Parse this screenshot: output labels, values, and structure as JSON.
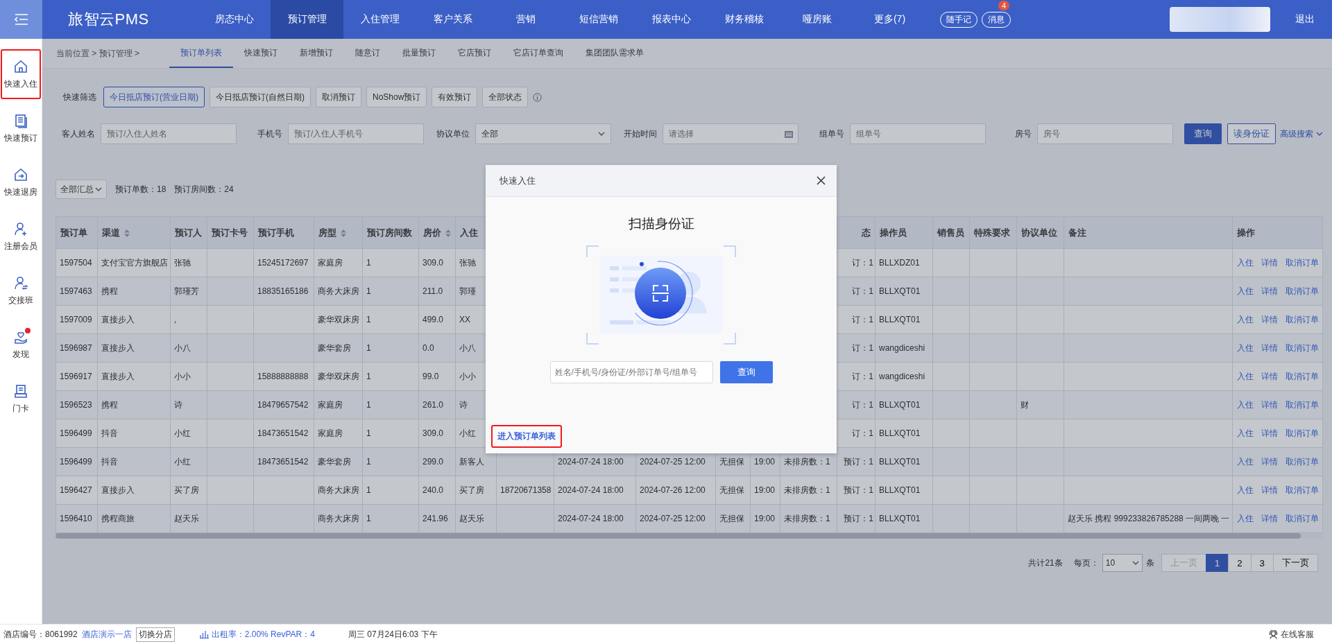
{
  "top_bar": {
    "logo": "旅智云PMS",
    "nav": [
      {
        "label": "房态中心",
        "selected": false
      },
      {
        "label": "预订管理",
        "selected": true
      },
      {
        "label": "入住管理",
        "selected": false
      },
      {
        "label": "客户关系",
        "selected": false
      },
      {
        "label": "营销",
        "selected": false
      },
      {
        "label": "短信营销",
        "selected": false
      },
      {
        "label": "报表中心",
        "selected": false
      },
      {
        "label": "财务稽核",
        "selected": false
      },
      {
        "label": "哑房账",
        "selected": false
      },
      {
        "label": "更多(7)",
        "selected": false
      }
    ],
    "quick_note": "随手记",
    "messages": {
      "label": "消息",
      "badge": "4"
    },
    "logout": "退出"
  },
  "sidebar": {
    "items": [
      {
        "label": "快速入住",
        "kind": "home",
        "highlighted": true,
        "notification": false
      },
      {
        "label": "快速预订",
        "kind": "document",
        "highlighted": false,
        "notification": false
      },
      {
        "label": "快速退房",
        "kind": "checkout",
        "highlighted": false,
        "notification": false
      },
      {
        "label": "注册会员",
        "kind": "member",
        "highlighted": false,
        "notification": false
      },
      {
        "label": "交接班",
        "kind": "handover",
        "highlighted": false,
        "notification": false
      },
      {
        "label": "发现",
        "kind": "discover",
        "highlighted": false,
        "notification": true
      },
      {
        "label": "门卡",
        "kind": "card",
        "highlighted": false,
        "notification": false
      }
    ]
  },
  "breadcrumb": "当前位置 > 预订管理 >",
  "sub_tabs": [
    {
      "label": "预订单列表",
      "selected": true
    },
    {
      "label": "快速预订",
      "selected": false
    },
    {
      "label": "新增预订",
      "selected": false
    },
    {
      "label": "随意订",
      "selected": false
    },
    {
      "label": "批量预订",
      "selected": false
    },
    {
      "label": "它店预订",
      "selected": false
    },
    {
      "label": "它店订单查询",
      "selected": false
    },
    {
      "label": "集团团队需求单",
      "selected": false
    }
  ],
  "quick_filter": {
    "label": "快速筛选",
    "options": [
      {
        "label": "今日抵店预订(营业日期)",
        "selected": true
      },
      {
        "label": "今日抵店预订(自然日期)",
        "selected": false
      },
      {
        "label": "取消预订",
        "selected": false
      },
      {
        "label": "NoShow预订",
        "selected": false
      },
      {
        "label": "有效预订",
        "selected": false
      },
      {
        "label": "全部状态",
        "selected": false
      }
    ]
  },
  "search_form": {
    "fields": [
      {
        "label": "客人姓名",
        "kind": "text",
        "placeholder": "预订/入住人姓名"
      },
      {
        "label": "手机号",
        "kind": "text",
        "placeholder": "预订/入住人手机号"
      },
      {
        "label": "协议单位",
        "kind": "select",
        "value": "全部"
      },
      {
        "label": "开始时间",
        "kind": "date",
        "placeholder": "请选择"
      },
      {
        "label": "组单号",
        "kind": "text",
        "placeholder": "组单号"
      },
      {
        "label": "房号",
        "kind": "text",
        "placeholder": "房号"
      }
    ],
    "search_button": "查询",
    "read_id_button": "读身份证",
    "advanced_link": "高级搜索"
  },
  "summary": {
    "scope": "全部汇总",
    "order_count": "预订单数：18",
    "room_count": "预订房间数：24"
  },
  "table": {
    "columns": [
      {
        "label": "预订单",
        "sortable": false
      },
      {
        "label": "渠道",
        "sortable": true
      },
      {
        "label": "预订人",
        "sortable": false
      },
      {
        "label": "预订卡号",
        "sortable": false
      },
      {
        "label": "预订手机",
        "sortable": false
      },
      {
        "label": "房型",
        "sortable": true
      },
      {
        "label": "预订房间数",
        "sortable": false
      },
      {
        "label": "房价",
        "sortable": true
      },
      {
        "label": "入住",
        "sortable": false
      },
      {},
      {},
      {},
      {},
      {},
      {},
      {
        "label": "态",
        "sortable": false
      },
      {
        "label": "操作员",
        "sortable": false
      },
      {
        "label": "销售员",
        "sortable": false
      },
      {
        "label": "特殊要求",
        "sortable": false
      },
      {
        "label": "协议单位",
        "sortable": false
      },
      {
        "label": "备注",
        "sortable": false
      },
      {
        "label": "操作",
        "sortable": false
      }
    ],
    "rows": [
      {
        "cells": [
          "1597504",
          "支付宝官方旗舰店",
          "张驰",
          null,
          "15245172697",
          "家庭房",
          "1",
          "309.0",
          "张驰",
          null,
          null,
          null,
          null,
          null,
          null,
          "订：1",
          "BLLXDZ01",
          null,
          null,
          null,
          null
        ],
        "actions": [
          "入住",
          "详情",
          "取消订单"
        ]
      },
      {
        "cells": [
          "1597463",
          "携程",
          "郭瑾芳",
          null,
          "18835165186",
          "商务大床房",
          "1",
          "211.0",
          "郭瑾",
          null,
          null,
          null,
          null,
          null,
          null,
          "订：1",
          "BLLXQT01",
          null,
          null,
          null,
          null
        ],
        "actions": [
          "入住",
          "详情",
          "取消订单"
        ]
      },
      {
        "cells": [
          "1597009",
          "直接步入",
          ",",
          null,
          null,
          "豪华双床房",
          "1",
          "499.0",
          "XX",
          null,
          null,
          null,
          null,
          null,
          null,
          "订：1",
          "BLLXQT01",
          null,
          null,
          null,
          null
        ],
        "actions": [
          "入住",
          "详情",
          "取消订单"
        ]
      },
      {
        "cells": [
          "1596987",
          "直接步入",
          "小八",
          null,
          null,
          "豪华套房",
          "1",
          "0.0",
          "小八",
          null,
          null,
          null,
          null,
          null,
          null,
          "订：1",
          "wangdiceshi",
          null,
          null,
          null,
          null
        ],
        "actions": [
          "入住",
          "详情",
          "取消订单"
        ]
      },
      {
        "cells": [
          "1596917",
          "直接步入",
          "小小",
          null,
          "15888888888",
          "豪华双床房",
          "1",
          "99.0",
          "小小",
          null,
          null,
          null,
          null,
          null,
          null,
          "订：1",
          "wangdiceshi",
          null,
          null,
          null,
          null
        ],
        "actions": [
          "入住",
          "详情",
          "取消订单"
        ]
      },
      {
        "cells": [
          "1596523",
          "携程",
          "诗",
          null,
          "18479657542",
          "家庭房",
          "1",
          "261.0",
          "诗",
          null,
          null,
          null,
          null,
          null,
          null,
          "订：1",
          "BLLXQT01",
          null,
          null,
          "财",
          null
        ],
        "actions": [
          "入住",
          "详情",
          "取消订单"
        ]
      },
      {
        "cells": [
          "1596499",
          "抖音",
          "小红",
          null,
          "18473651542",
          "家庭房",
          "1",
          "309.0",
          "小红",
          null,
          null,
          null,
          null,
          null,
          null,
          "订：1",
          "BLLXQT01",
          null,
          null,
          null,
          null
        ],
        "actions": [
          "入住",
          "详情",
          "取消订单"
        ]
      },
      {
        "cells": [
          "1596499",
          "抖音",
          "小红",
          null,
          "18473651542",
          "豪华套房",
          "1",
          "299.0",
          "新客人",
          null,
          "2024-07-24 18:00",
          "2024-07-25 12:00",
          "无担保",
          "19:00",
          "未排房数：1",
          "预订：1",
          "BLLXQT01",
          null,
          null,
          null,
          null
        ],
        "actions": [
          "入住",
          "详情",
          "取消订单"
        ]
      },
      {
        "cells": [
          "1596427",
          "直接步入",
          "买了房",
          null,
          null,
          "商务大床房",
          "1",
          "240.0",
          "买了房",
          "18720671358",
          "2024-07-24 18:00",
          "2024-07-26 12:00",
          "无担保",
          "19:00",
          "未排房数：1",
          "预订：1",
          "BLLXQT01",
          null,
          null,
          null,
          null
        ],
        "actions": [
          "入住",
          "详情",
          "取消订单"
        ]
      },
      {
        "cells": [
          "1596410",
          "携程商旅",
          "赵天乐",
          null,
          null,
          "商务大床房",
          "1",
          "241.96",
          "赵天乐",
          null,
          "2024-07-24 18:00",
          "2024-07-25 12:00",
          "无担保",
          "19:00",
          "未排房数：1",
          "预订：1",
          "BLLXQT01",
          null,
          null,
          null,
          "赵天乐 携程 999233826785288 一间两晚 一"
        ],
        "actions": [
          "入住",
          "详情",
          "取消订单"
        ]
      }
    ]
  },
  "pagination": {
    "total": "共计21条",
    "per_page_label": "每页：",
    "per_page": "10",
    "per_page_unit": "条",
    "prev": {
      "label": "上一页",
      "disabled": true
    },
    "pages": [
      {
        "label": "1",
        "selected": true
      },
      {
        "label": "2",
        "selected": false
      },
      {
        "label": "3",
        "selected": false
      }
    ],
    "next": {
      "label": "下一页",
      "disabled": false
    }
  },
  "status_bar": {
    "hotel_no": "酒店编号：8061992",
    "hotel_name": "酒店演示一店",
    "switch_button": "切换分店",
    "occupancy": "出租率：2.00% RevPAR：4",
    "datetime": "周三 07月24日6:03 下午",
    "support": "在线客服"
  },
  "modal": {
    "title": "快速入住",
    "heading": "扫描身份证",
    "search": {
      "placeholder": "姓名/手机号/身份证/外部订单号/组单号"
    },
    "search_button": "查询",
    "list_link": {
      "label": "进入预订单列表",
      "highlighted": true
    }
  }
}
